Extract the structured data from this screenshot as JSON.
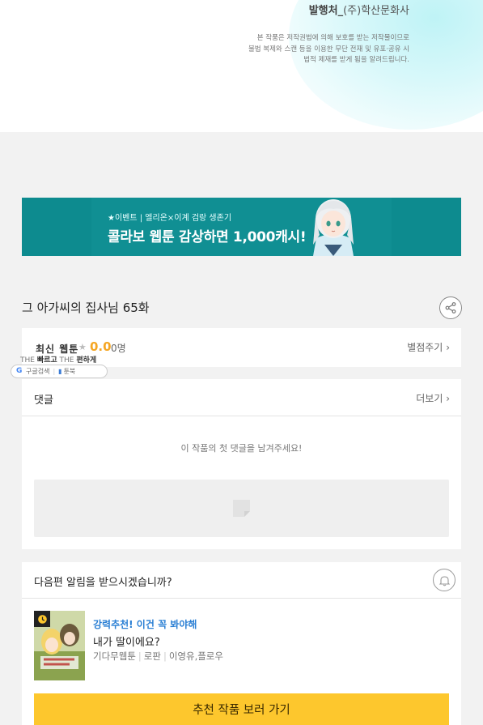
{
  "publisher": {
    "label": "발행처_",
    "name": "(주)학산문화사",
    "copyright_lines": [
      "본 작품은 저작권법에 의해 보호를 받는 저작물이므로",
      "불법 복제와 스캔 등을 이용한 무단 전재 및 유포·공유 시",
      "법적 제재를 받게 됨을 알려드립니다."
    ]
  },
  "banner": {
    "small_text": "★이벤트 | 엘리온×이계 검랑 생존기",
    "big_text": "콜라보 웹툰 감상하면 1,000캐시!",
    "bg_color": "#0d8b8f"
  },
  "episode": {
    "title": "그 아가씨의 집사님 65화",
    "share_icon": "share-icon"
  },
  "rating": {
    "score": "0.0",
    "count": "0명",
    "rate_link": "별점주기",
    "star_icon": "star-icon",
    "accent_color": "#f5a623"
  },
  "overlay": {
    "latest": "최신 웹툰",
    "tag_prefix1": "THE ",
    "tag_word1": "빠르고",
    "tag_prefix2": " THE ",
    "tag_word2": "편하게",
    "pill_left": "구글검색",
    "pill_right": "툰북"
  },
  "comments": {
    "heading": "댓글",
    "more_link": "더보기",
    "empty_message": "이 작품의 첫 댓글을 남겨주세요!"
  },
  "notify": {
    "question": "다음편 알림을 받으시겠습니까?",
    "bell_icon": "bell-icon",
    "recommend": {
      "headline": "강력추천! 이건 꼭 봐야해",
      "title": "내가 딸이에요?",
      "meta": [
        "기다무웹툰",
        "로판",
        "이영유,플로우"
      ],
      "badge_icon": "clock-icon"
    },
    "button_label": "추천 작품 보러 가기",
    "button_color": "#fdc72d"
  }
}
